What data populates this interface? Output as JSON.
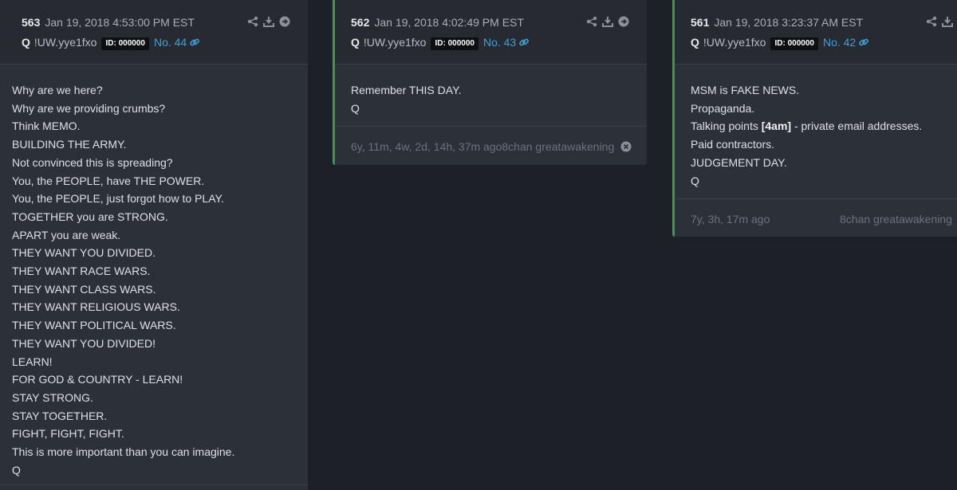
{
  "posts": [
    {
      "number": "563",
      "date": "Jan 19, 2018 4:53:00 PM EST",
      "author": "Q",
      "tripcode": "!UW.yye1fxo",
      "id_badge": "ID: 000000",
      "post_no": "No. 44",
      "lines": [
        "Why are we here?",
        "Why are we providing crumbs?",
        "Think MEMO.",
        "BUILDING THE ARMY.",
        "Not convinced this is spreading?",
        "You, the PEOPLE, have THE POWER.",
        "You, the PEOPLE, just forgot how to PLAY.",
        "TOGETHER you are STRONG.",
        "APART you are weak.",
        "THEY WANT YOU DIVIDED.",
        "THEY WANT RACE WARS.",
        "THEY WANT CLASS WARS.",
        "THEY WANT RELIGIOUS WARS.",
        "THEY WANT POLITICAL WARS.",
        "THEY WANT YOU DIVIDED!",
        "LEARN!",
        "FOR GOD & COUNTRY - LEARN!",
        "STAY STRONG.",
        "STAY TOGETHER.",
        "FIGHT, FIGHT, FIGHT.",
        "This is more important than you can imagine.",
        "Q"
      ]
    },
    {
      "number": "562",
      "date": "Jan 19, 2018 4:02:49 PM EST",
      "author": "Q",
      "tripcode": "!UW.yye1fxo",
      "id_badge": "ID: 000000",
      "post_no": "No. 43",
      "lines": [
        "Remember THIS DAY.",
        "Q"
      ],
      "footer_text": "6y, 11m, 4w, 2d, 14h, 37m ago8chan greatawakening"
    },
    {
      "number": "561",
      "date": "Jan 19, 2018 3:23:37 AM EST",
      "author": "Q",
      "tripcode": "!UW.yye1fxo",
      "id_badge": "ID: 000000",
      "post_no": "No. 42",
      "lines": [
        "MSM is FAKE NEWS.",
        "Propaganda.",
        "",
        "Paid contractors.",
        "JUDGEMENT DAY.",
        "Q"
      ],
      "line3_pre": "Talking points ",
      "line3_bold": "[4am]",
      "line3_post": " - private email addresses.",
      "footer_age": "7y, 3h, 17m ago",
      "footer_source": "8chan greatawakening"
    }
  ],
  "colors": {
    "background": "#1d2027",
    "card": "#2c3038",
    "accent_green": "#3a9b4a",
    "link_blue": "#3da0d6"
  },
  "icons": [
    "share-icon",
    "download-icon",
    "arrow-circle-icon",
    "link-icon",
    "close-circle-icon"
  ]
}
